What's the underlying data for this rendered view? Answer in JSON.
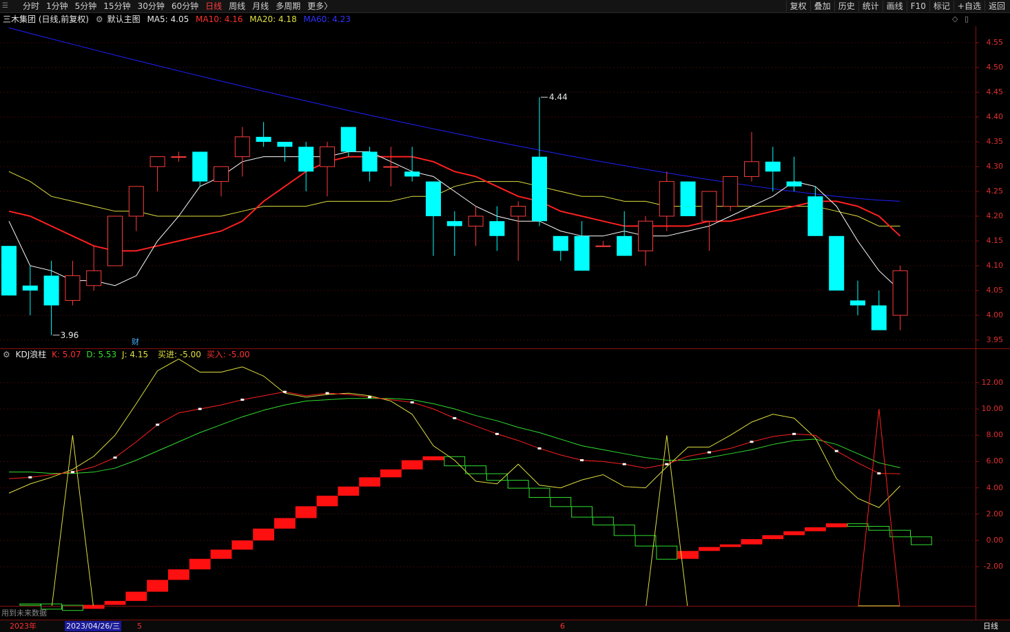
{
  "toolbar": {
    "left": [
      "分时",
      "1分钟",
      "5分钟",
      "15分钟",
      "30分钟",
      "60分钟",
      "日线",
      "周线",
      "月线",
      "多周期",
      "更多〉"
    ],
    "active": "日线",
    "right": [
      "复权",
      "叠加",
      "历史",
      "统计",
      "画线",
      "F10",
      "标记",
      "+自选",
      "返回"
    ]
  },
  "main_info": {
    "stock": "三木集团 (日线,前复权)",
    "template": "默认主图",
    "ma5": "MA5: 4.05",
    "ma10": "MA10: 4.16",
    "ma20": "MA20: 4.18",
    "ma60": "MA60: 4.23"
  },
  "colors": {
    "up": "#ff3c3c",
    "down": "#00ffff",
    "ma5": "#ffffff",
    "ma10": "#ff2020",
    "ma20": "#e0e040",
    "ma60": "#2020ff"
  },
  "price_axis": [
    "4.55",
    "4.50",
    "4.45",
    "4.40",
    "4.35",
    "4.30",
    "4.25",
    "4.20",
    "4.15",
    "4.10",
    "4.05",
    "4.00",
    "3.95"
  ],
  "price_labels": {
    "high": "4.44",
    "low": "3.96",
    "cai": "财"
  },
  "kdj_info": {
    "name": "KDJ浪柱",
    "k": "K: 5.07",
    "d": "D: 5.53",
    "j": "J: 4.15",
    "buyin": "买进: -5.00",
    "buy": "买入: -5.00"
  },
  "kdj_axis": [
    "12.00",
    "10.00",
    "8.00",
    "6.00",
    "4.00",
    "2.00",
    "0.00",
    "-2.00"
  ],
  "bottom": {
    "year": "2023年",
    "date": "2023/04/26/三",
    "m5": "5",
    "m6": "6",
    "period": "日线",
    "overlay": "用到未来数据"
  },
  "chart_data": {
    "type": "candlestick",
    "ylim": [
      3.93,
      4.58
    ],
    "candles": [
      [
        4.14,
        4.14,
        4.04,
        4.04
      ],
      [
        4.06,
        4.1,
        4.0,
        4.05
      ],
      [
        4.08,
        4.11,
        3.96,
        4.02
      ],
      [
        4.03,
        4.11,
        4.02,
        4.08
      ],
      [
        4.06,
        4.14,
        4.05,
        4.09
      ],
      [
        4.1,
        4.2,
        4.1,
        4.2
      ],
      [
        4.2,
        4.26,
        4.17,
        4.26
      ],
      [
        4.3,
        4.32,
        4.25,
        4.32
      ],
      [
        4.32,
        4.33,
        4.31,
        4.32
      ],
      [
        4.33,
        4.33,
        4.26,
        4.27
      ],
      [
        4.27,
        4.3,
        4.24,
        4.3
      ],
      [
        4.32,
        4.38,
        4.28,
        4.36
      ],
      [
        4.36,
        4.39,
        4.34,
        4.35
      ],
      [
        4.35,
        4.35,
        4.31,
        4.34
      ],
      [
        4.34,
        4.35,
        4.25,
        4.29
      ],
      [
        4.3,
        4.35,
        4.24,
        4.34
      ],
      [
        4.38,
        4.38,
        4.32,
        4.33
      ],
      [
        4.33,
        4.34,
        4.27,
        4.29
      ],
      [
        4.3,
        4.34,
        4.26,
        4.3
      ],
      [
        4.29,
        4.34,
        4.27,
        4.28
      ],
      [
        4.27,
        4.27,
        4.12,
        4.2
      ],
      [
        4.19,
        4.21,
        4.12,
        4.18
      ],
      [
        4.18,
        4.22,
        4.14,
        4.2
      ],
      [
        4.19,
        4.22,
        4.13,
        4.16
      ],
      [
        4.2,
        4.23,
        4.11,
        4.22
      ],
      [
        4.32,
        4.44,
        4.18,
        4.19
      ],
      [
        4.16,
        4.16,
        4.11,
        4.13
      ],
      [
        4.16,
        4.19,
        4.09,
        4.09
      ],
      [
        4.14,
        4.15,
        4.14,
        4.14
      ],
      [
        4.16,
        4.21,
        4.12,
        4.12
      ],
      [
        4.13,
        4.2,
        4.1,
        4.19
      ],
      [
        4.2,
        4.29,
        4.17,
        4.27
      ],
      [
        4.27,
        4.27,
        4.2,
        4.2
      ],
      [
        4.19,
        4.25,
        4.13,
        4.25
      ],
      [
        4.22,
        4.28,
        4.21,
        4.28
      ],
      [
        4.28,
        4.37,
        4.27,
        4.31
      ],
      [
        4.31,
        4.34,
        4.25,
        4.29
      ],
      [
        4.27,
        4.32,
        4.25,
        4.26
      ],
      [
        4.24,
        4.26,
        4.16,
        4.16
      ],
      [
        4.16,
        4.16,
        4.05,
        4.05
      ],
      [
        4.03,
        4.07,
        4.0,
        4.02
      ],
      [
        4.02,
        4.05,
        3.97,
        3.97
      ],
      [
        4.0,
        4.1,
        3.97,
        4.09
      ]
    ],
    "ma5": [
      4.19,
      4.1,
      4.09,
      4.07,
      4.07,
      4.06,
      4.08,
      4.15,
      4.2,
      4.26,
      4.28,
      4.31,
      4.32,
      4.32,
      4.32,
      4.32,
      4.33,
      4.33,
      4.31,
      4.29,
      4.28,
      4.25,
      4.22,
      4.2,
      4.19,
      4.19,
      4.17,
      4.16,
      4.16,
      4.17,
      4.16,
      4.16,
      4.17,
      4.18,
      4.2,
      4.22,
      4.24,
      4.27,
      4.26,
      4.22,
      4.15,
      4.09,
      4.05
    ],
    "ma10": [
      4.21,
      4.2,
      4.18,
      4.16,
      4.14,
      4.13,
      4.13,
      4.14,
      4.15,
      4.16,
      4.17,
      4.19,
      4.23,
      4.26,
      4.29,
      4.31,
      4.32,
      4.32,
      4.32,
      4.32,
      4.31,
      4.29,
      4.28,
      4.26,
      4.24,
      4.23,
      4.21,
      4.2,
      4.19,
      4.18,
      4.18,
      4.18,
      4.18,
      4.19,
      4.19,
      4.2,
      4.21,
      4.22,
      4.23,
      4.23,
      4.22,
      4.2,
      4.16
    ],
    "ma20": [
      4.29,
      4.27,
      4.24,
      4.23,
      4.22,
      4.21,
      4.21,
      4.2,
      4.2,
      4.2,
      4.2,
      4.21,
      4.22,
      4.22,
      4.22,
      4.23,
      4.23,
      4.23,
      4.23,
      4.24,
      4.24,
      4.26,
      4.27,
      4.27,
      4.27,
      4.26,
      4.25,
      4.24,
      4.24,
      4.23,
      4.23,
      4.22,
      4.22,
      4.22,
      4.22,
      4.22,
      4.22,
      4.22,
      4.22,
      4.21,
      4.2,
      4.18,
      4.18
    ],
    "ma60_start": 4.58,
    "ma60_end": 4.23,
    "kdj_ylim": [
      -5.5,
      14.5
    ],
    "kdj_k": [
      4.7,
      4.8,
      5.0,
      5.2,
      5.6,
      6.3,
      7.5,
      8.8,
      9.7,
      10.0,
      10.3,
      10.7,
      11.0,
      11.3,
      11.0,
      11.2,
      11.1,
      10.9,
      10.7,
      10.5,
      10.0,
      9.3,
      8.7,
      8.1,
      7.6,
      7.0,
      6.5,
      6.1,
      6.0,
      5.8,
      5.5,
      5.8,
      6.4,
      6.7,
      7.0,
      7.5,
      7.9,
      8.1,
      8.0,
      6.8,
      5.9,
      5.1,
      5.07
    ],
    "kdj_d": [
      5.2,
      5.2,
      5.1,
      5.1,
      5.2,
      5.5,
      6.1,
      6.8,
      7.5,
      8.2,
      8.8,
      9.4,
      9.9,
      10.3,
      10.6,
      10.7,
      10.8,
      10.8,
      10.8,
      10.7,
      10.4,
      10.0,
      9.5,
      9.1,
      8.6,
      8.2,
      7.7,
      7.2,
      6.9,
      6.6,
      6.3,
      6.1,
      6.1,
      6.3,
      6.6,
      6.9,
      7.3,
      7.6,
      7.7,
      7.3,
      6.6,
      5.9,
      5.53
    ],
    "kdj_j": [
      3.6,
      4.3,
      4.8,
      5.4,
      6.4,
      8.0,
      10.4,
      12.9,
      13.8,
      12.8,
      12.8,
      13.2,
      12.5,
      11.2,
      10.9,
      11.1,
      11.2,
      11.0,
      10.6,
      9.6,
      7.2,
      6.1,
      4.5,
      4.3,
      5.8,
      4.2,
      4.0,
      4.6,
      5.0,
      4.1,
      4.0,
      5.6,
      7.1,
      7.1,
      8.0,
      9.0,
      9.6,
      9.3,
      7.8,
      4.7,
      3.2,
      2.5,
      4.15
    ],
    "spikes_j": [
      3,
      31
    ],
    "spike_red": 41,
    "waves": [
      [
        1,
        -4.8,
        -4.8,
        "g"
      ],
      [
        2,
        -4.8,
        -5.2,
        "g"
      ],
      [
        3,
        -4.9,
        -5.3,
        "g"
      ],
      [
        4,
        -4.9,
        -5.2,
        "r"
      ],
      [
        5,
        -4.9,
        -4.6,
        "r"
      ],
      [
        6,
        -4.6,
        -3.9,
        "r"
      ],
      [
        7,
        -3.9,
        -3.0,
        "r"
      ],
      [
        8,
        -3.0,
        -2.2,
        "r"
      ],
      [
        9,
        -2.2,
        -1.4,
        "r"
      ],
      [
        10,
        -1.4,
        -0.7,
        "r"
      ],
      [
        11,
        -0.7,
        0.0,
        "r"
      ],
      [
        12,
        0.0,
        0.9,
        "r"
      ],
      [
        13,
        0.9,
        1.7,
        "r"
      ],
      [
        14,
        1.7,
        2.6,
        "r"
      ],
      [
        15,
        2.6,
        3.4,
        "r"
      ],
      [
        16,
        3.4,
        4.1,
        "r"
      ],
      [
        17,
        4.1,
        4.8,
        "r"
      ],
      [
        18,
        4.8,
        5.4,
        "r"
      ],
      [
        19,
        5.4,
        6.1,
        "r"
      ],
      [
        20,
        6.1,
        6.4,
        "r"
      ],
      [
        21,
        6.4,
        5.7,
        "g"
      ],
      [
        22,
        5.7,
        5.1,
        "g"
      ],
      [
        23,
        5.1,
        4.6,
        "g"
      ],
      [
        24,
        4.6,
        4.0,
        "g"
      ],
      [
        25,
        4.0,
        3.3,
        "g"
      ],
      [
        26,
        3.3,
        2.6,
        "g"
      ],
      [
        27,
        2.6,
        1.8,
        "g"
      ],
      [
        28,
        1.8,
        1.2,
        "g"
      ],
      [
        29,
        1.2,
        0.4,
        "g"
      ],
      [
        30,
        0.4,
        -0.4,
        "g"
      ],
      [
        31,
        -0.4,
        -1.4,
        "g"
      ],
      [
        32,
        -1.4,
        -0.8,
        "r"
      ],
      [
        33,
        -0.8,
        -0.5,
        "r"
      ],
      [
        34,
        -0.5,
        -0.3,
        "r"
      ],
      [
        35,
        -0.3,
        0.1,
        "r"
      ],
      [
        36,
        0.1,
        0.4,
        "r"
      ],
      [
        37,
        0.4,
        0.7,
        "r"
      ],
      [
        38,
        0.7,
        1.0,
        "r"
      ],
      [
        39,
        1.0,
        1.3,
        "r"
      ],
      [
        40,
        1.3,
        1.1,
        "g"
      ],
      [
        41,
        1.1,
        0.8,
        "g"
      ],
      [
        42,
        0.8,
        0.3,
        "g"
      ],
      [
        43,
        0.3,
        -0.3,
        "g"
      ]
    ]
  }
}
